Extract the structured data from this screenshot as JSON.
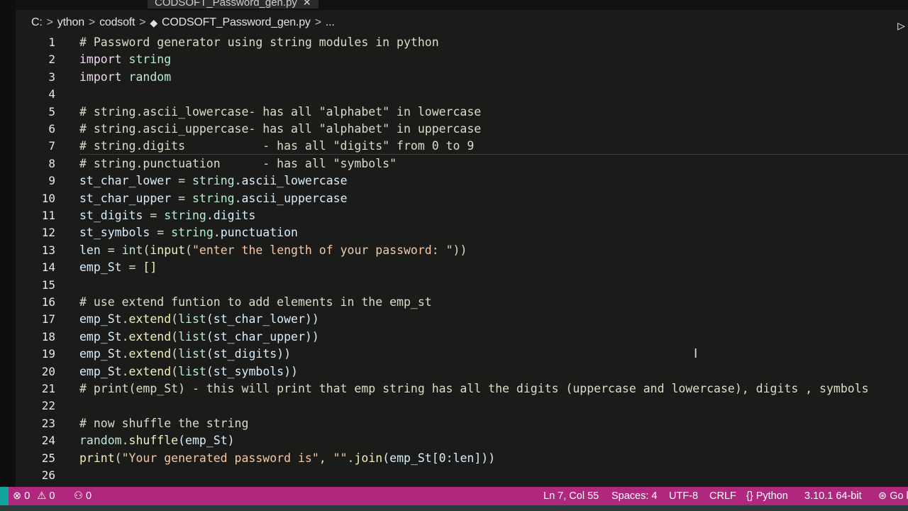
{
  "tab": {
    "filename": "CODSOFT_Password_gen.py",
    "close_glyph": "✕"
  },
  "breadcrumb": {
    "items": [
      "C:",
      "ython",
      "codsoft",
      "CODSOFT_Password_gen.py",
      "..."
    ],
    "separator": ">"
  },
  "editor": {
    "lines": [
      {
        "num": "1",
        "tokens": [
          {
            "t": "# Password generator using string modules in python",
            "c": "cm"
          }
        ]
      },
      {
        "num": "2",
        "tokens": [
          {
            "t": "import ",
            "c": "kw"
          },
          {
            "t": "string",
            "c": "mod"
          }
        ]
      },
      {
        "num": "3",
        "tokens": [
          {
            "t": "import ",
            "c": "kw"
          },
          {
            "t": "random",
            "c": "mod"
          }
        ]
      },
      {
        "num": "4",
        "tokens": []
      },
      {
        "num": "5",
        "tokens": [
          {
            "t": "# string.ascii_lowercase- has all \"alphabet\" in lowercase",
            "c": "cm"
          }
        ]
      },
      {
        "num": "6",
        "tokens": [
          {
            "t": "# string.ascii_uppercase- has all \"alphabet\" in uppercase",
            "c": "cm"
          }
        ]
      },
      {
        "num": "7",
        "tokens": [
          {
            "t": "# string.digits           - has all \"digits\" from 0 to 9",
            "c": "cm"
          }
        ]
      },
      {
        "num": "8",
        "tokens": [
          {
            "t": "# string.punctuation      - has all \"symbols\"",
            "c": "cm"
          }
        ]
      },
      {
        "num": "9",
        "tokens": [
          {
            "t": "st_char_lower",
            "c": "var"
          },
          {
            "t": " = ",
            "c": "cm"
          },
          {
            "t": "string",
            "c": "mod"
          },
          {
            "t": ".ascii_lowercase",
            "c": "var"
          }
        ]
      },
      {
        "num": "10",
        "tokens": [
          {
            "t": "st_char_upper",
            "c": "var"
          },
          {
            "t": " = ",
            "c": "cm"
          },
          {
            "t": "string",
            "c": "mod"
          },
          {
            "t": ".ascii_uppercase",
            "c": "var"
          }
        ]
      },
      {
        "num": "11",
        "tokens": [
          {
            "t": "st_digits",
            "c": "var"
          },
          {
            "t": " = ",
            "c": "cm"
          },
          {
            "t": "string",
            "c": "mod"
          },
          {
            "t": ".digits",
            "c": "var"
          }
        ]
      },
      {
        "num": "12",
        "tokens": [
          {
            "t": "st_symbols",
            "c": "var"
          },
          {
            "t": " = ",
            "c": "cm"
          },
          {
            "t": "string",
            "c": "mod"
          },
          {
            "t": ".punctuation",
            "c": "var"
          }
        ]
      },
      {
        "num": "13",
        "tokens": [
          {
            "t": "len",
            "c": "var"
          },
          {
            "t": " = ",
            "c": "cm"
          },
          {
            "t": "int",
            "c": "mod"
          },
          {
            "t": "(",
            "c": "cm"
          },
          {
            "t": "input",
            "c": "fn"
          },
          {
            "t": "(",
            "c": "cm"
          },
          {
            "t": "\"enter the length of your password: \"",
            "c": "str"
          },
          {
            "t": "))",
            "c": "cm"
          }
        ]
      },
      {
        "num": "14",
        "tokens": [
          {
            "t": "emp_St",
            "c": "var"
          },
          {
            "t": " = ",
            "c": "cm"
          },
          {
            "t": "[]",
            "c": "fn"
          }
        ]
      },
      {
        "num": "15",
        "tokens": []
      },
      {
        "num": "16",
        "tokens": [
          {
            "t": "# use extend funtion to add elements in the emp_st",
            "c": "cm"
          }
        ]
      },
      {
        "num": "17",
        "tokens": [
          {
            "t": "emp_St",
            "c": "var"
          },
          {
            "t": ".",
            "c": "cm"
          },
          {
            "t": "extend",
            "c": "fn"
          },
          {
            "t": "(",
            "c": "cm"
          },
          {
            "t": "list",
            "c": "mod"
          },
          {
            "t": "(st_char_lower))",
            "c": "var"
          }
        ]
      },
      {
        "num": "18",
        "tokens": [
          {
            "t": "emp_St",
            "c": "var"
          },
          {
            "t": ".",
            "c": "cm"
          },
          {
            "t": "extend",
            "c": "fn"
          },
          {
            "t": "(",
            "c": "cm"
          },
          {
            "t": "list",
            "c": "mod"
          },
          {
            "t": "(st_char_upper))",
            "c": "var"
          }
        ]
      },
      {
        "num": "19",
        "tokens": [
          {
            "t": "emp_St",
            "c": "var"
          },
          {
            "t": ".",
            "c": "cm"
          },
          {
            "t": "extend",
            "c": "fn"
          },
          {
            "t": "(",
            "c": "cm"
          },
          {
            "t": "list",
            "c": "mod"
          },
          {
            "t": "(st_digits))",
            "c": "var"
          }
        ]
      },
      {
        "num": "20",
        "tokens": [
          {
            "t": "emp_St",
            "c": "var"
          },
          {
            "t": ".",
            "c": "cm"
          },
          {
            "t": "extend",
            "c": "fn"
          },
          {
            "t": "(",
            "c": "cm"
          },
          {
            "t": "list",
            "c": "mod"
          },
          {
            "t": "(st_symbols))",
            "c": "var"
          }
        ]
      },
      {
        "num": "21",
        "tokens": [
          {
            "t": "# print(emp_St) - this will print that emp string has all the digits (uppercase and lowercase), digits , symbols",
            "c": "cm"
          }
        ]
      },
      {
        "num": "22",
        "tokens": []
      },
      {
        "num": "23",
        "tokens": [
          {
            "t": "# now shuffle the string",
            "c": "cm"
          }
        ]
      },
      {
        "num": "24",
        "tokens": [
          {
            "t": "random",
            "c": "mod"
          },
          {
            "t": ".",
            "c": "cm"
          },
          {
            "t": "shuffle",
            "c": "fn"
          },
          {
            "t": "(emp_St)",
            "c": "var"
          }
        ]
      },
      {
        "num": "25",
        "tokens": [
          {
            "t": "print",
            "c": "fn"
          },
          {
            "t": "(",
            "c": "cm"
          },
          {
            "t": "\"Your generated password is\"",
            "c": "str"
          },
          {
            "t": ", ",
            "c": "cm"
          },
          {
            "t": "\"\"",
            "c": "str"
          },
          {
            "t": ".",
            "c": "cm"
          },
          {
            "t": "join",
            "c": "fn"
          },
          {
            "t": "(emp_St[0:len]))",
            "c": "var"
          }
        ]
      },
      {
        "num": "26",
        "tokens": []
      }
    ]
  },
  "status_bar": {
    "errors": "0",
    "warnings": "0",
    "ports": "0",
    "cursor_position": "Ln 7, Col 55",
    "indentation": "Spaces: 4",
    "encoding": "UTF-8",
    "eol": "CRLF",
    "language": "Python",
    "interpreter": "3.10.1 64-bit",
    "go_live": "Go l"
  },
  "colors": {
    "background": "#1b1b1a",
    "status_bar": "#b0287e",
    "remote_indicator": "#12a5a0"
  }
}
